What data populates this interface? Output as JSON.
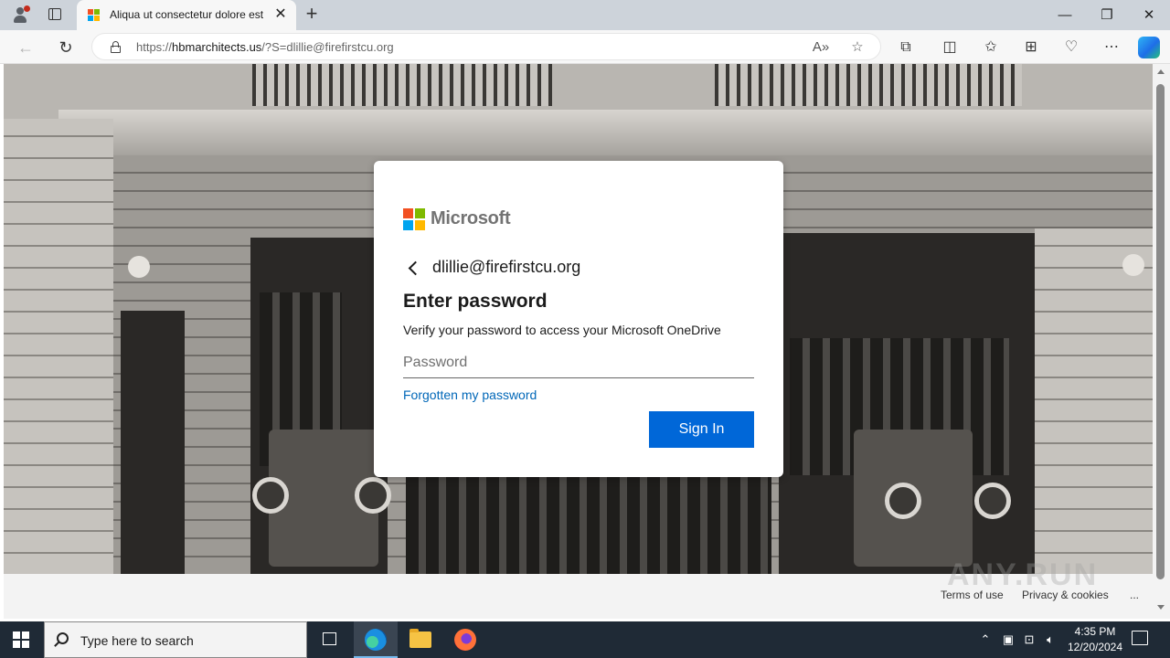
{
  "browser": {
    "tab_title": "Aliqua ut consectetur dolore est",
    "tab_close": "✕",
    "new_tab": "+",
    "url_prefix": "https://",
    "url_host": "hbmarchitects.us",
    "url_path": "/?S=dlillie@firefirstcu.org",
    "window_controls": {
      "minimize": "—",
      "restore": "❐",
      "close": "✕"
    },
    "nav": {
      "back": "←",
      "refresh": "↻"
    },
    "toolbar_icons": [
      "read-aloud-icon",
      "favorite-star-icon",
      "extensions-icon",
      "split-screen-icon",
      "favorites-icon",
      "collections-icon",
      "browser-essentials-icon",
      "more-icon",
      "copilot-icon"
    ]
  },
  "login": {
    "brand": "Microsoft",
    "brand_colors": {
      "red": "#f25022",
      "green": "#7fba00",
      "blue": "#00a4ef",
      "yellow": "#ffb900"
    },
    "identity": "dlillie@firefirstcu.org",
    "heading": "Enter password",
    "subtext": "Verify your password to access your Microsoft OneDrive",
    "password_placeholder": "Password",
    "forgot_link": "Forgotten my password",
    "signin_label": "Sign In",
    "accent_color": "#0067d8"
  },
  "page_footer": {
    "terms": "Terms of use",
    "privacy": "Privacy & cookies",
    "more": "..."
  },
  "taskbar": {
    "search_placeholder": "Type here to search",
    "time": "4:35 PM",
    "date": "12/20/2024"
  }
}
